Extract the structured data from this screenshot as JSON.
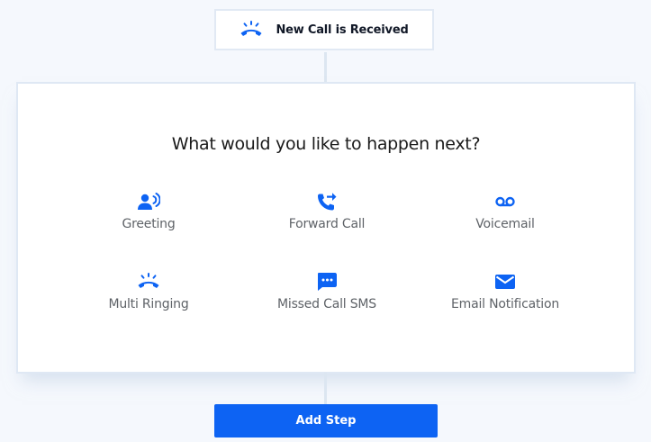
{
  "trigger": {
    "label": "New Call is Received",
    "icon": "multi-ringing-icon"
  },
  "panel": {
    "title": "What would you like to happen next?",
    "options": [
      {
        "label": "Greeting",
        "icon": "greeting-icon"
      },
      {
        "label": "Forward Call",
        "icon": "forward-call-icon"
      },
      {
        "label": "Voicemail",
        "icon": "voicemail-icon"
      },
      {
        "label": "Multi Ringing",
        "icon": "multi-ringing-icon"
      },
      {
        "label": "Missed Call SMS",
        "icon": "sms-icon"
      },
      {
        "label": "Email Notification",
        "icon": "email-icon"
      }
    ]
  },
  "actions": {
    "add_step_label": "Add Step"
  },
  "colors": {
    "accent": "#0d63f3",
    "background": "#f5f8fd",
    "border": "#dfe8f4",
    "text": "#1a1a1a",
    "muted_text": "#5f6368"
  }
}
